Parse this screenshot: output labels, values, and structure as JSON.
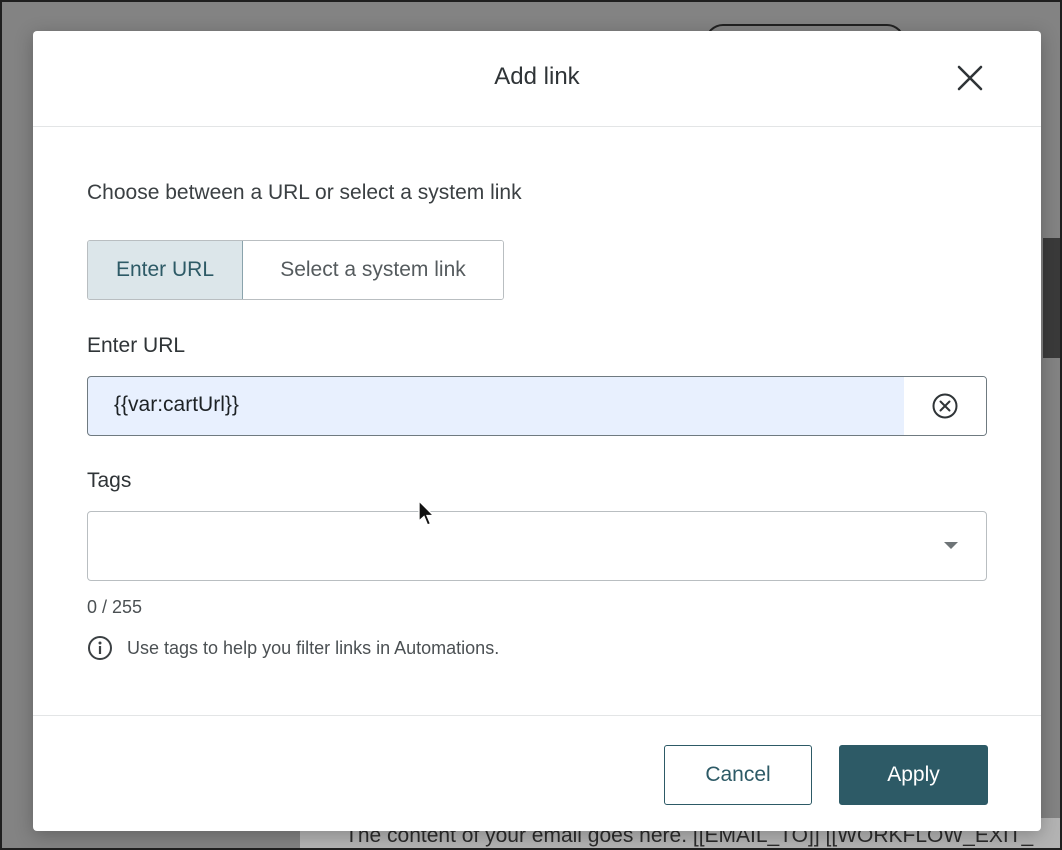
{
  "background": {
    "email_text": "The content of your email goes here. [[EMAIL_TO]] [[WORKFLOW_EXIT_"
  },
  "modal": {
    "title": "Add link",
    "close_icon": "close-icon"
  },
  "body": {
    "prompt": "Choose between a URL or select a system link",
    "segments": [
      {
        "label": "Enter URL",
        "active": true
      },
      {
        "label": "Select a system link",
        "active": false
      }
    ],
    "url_label": "Enter URL",
    "url_value": "{{var:cartUrl}}",
    "clear_icon": "clear-circle-icon",
    "tags_label": "Tags",
    "tags_value": "",
    "dropdown_icon": "caret-down-icon",
    "counter": "0 / 255",
    "hint_icon": "info-icon",
    "hint": "Use tags to help you filter links in Automations."
  },
  "footer": {
    "cancel_label": "Cancel",
    "apply_label": "Apply"
  },
  "colors": {
    "accent": "#2d5a66",
    "segment_active_bg": "#dce6ea",
    "input_autofill_bg": "#e8f0fe"
  }
}
